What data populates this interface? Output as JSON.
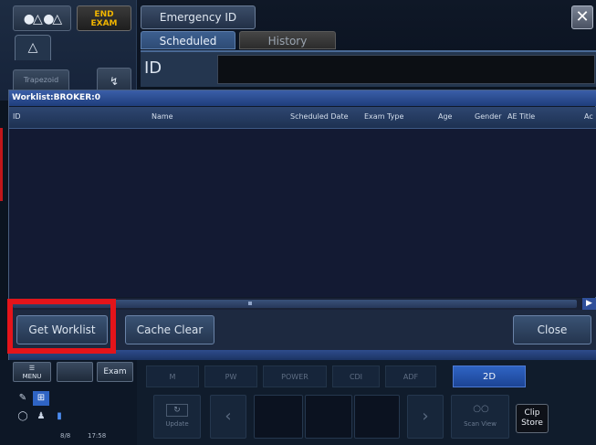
{
  "top_left": {
    "person_icon": "person-pair-icon",
    "end_exam_label": "END\nEXAM",
    "probe_icon": "probe-icon",
    "trapezoid_label": "Trapezoid",
    "tool_icon": "wrench-icon"
  },
  "header": {
    "emergency_label": "Emergency ID",
    "close_glyph": "✕",
    "tabs": [
      {
        "label": "Scheduled",
        "active": true
      },
      {
        "label": "History",
        "active": false
      }
    ],
    "id_label": "ID",
    "id_value": ""
  },
  "worklist": {
    "title": "Worklist:BROKER:0",
    "columns": [
      "ID",
      "Name",
      "Scheduled Date",
      "Exam Type",
      "Age",
      "Gender",
      "AE Title",
      "Ac"
    ],
    "rows": [],
    "scroll_right_glyph": "▶",
    "buttons": {
      "get_worklist": "Get Worklist",
      "cache_clear": "Cache Clear",
      "close": "Close"
    }
  },
  "bottom_left": {
    "menu_label": "MENU",
    "exam_label": "Exam",
    "counter_a": "8/8",
    "counter_b": "17:58"
  },
  "bottom_right": {
    "modes": [
      "M",
      "PW",
      "POWER",
      "CDI",
      "ADF",
      "2D"
    ],
    "active_mode": "2D",
    "update_label": "Update",
    "left_arrow": "‹",
    "right_arrow": "›",
    "scan_label": "Scan View",
    "clip_store_label": "Clip\nStore"
  },
  "colors": {
    "accent_blue": "#2f64c4",
    "highlight_red": "#e4141a",
    "end_exam_yellow": "#f0b400"
  }
}
